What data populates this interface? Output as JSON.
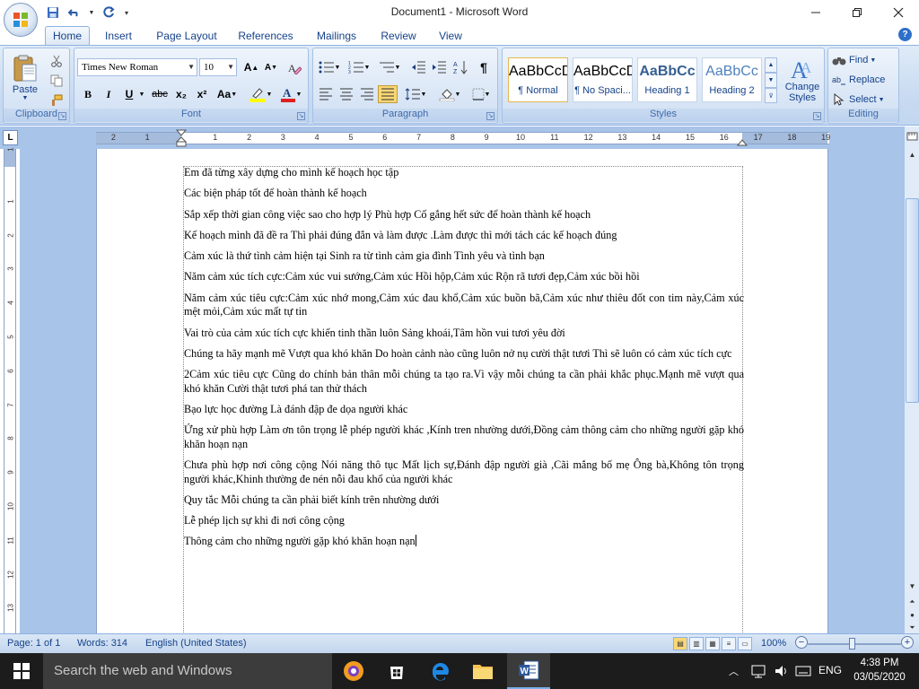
{
  "window": {
    "title": "Document1 - Microsoft Word"
  },
  "qat": {
    "save": "save-icon",
    "undo": "undo-icon",
    "redo": "redo-icon"
  },
  "tabs": [
    {
      "label": "Home",
      "active": true
    },
    {
      "label": "Insert"
    },
    {
      "label": "Page Layout"
    },
    {
      "label": "References"
    },
    {
      "label": "Mailings"
    },
    {
      "label": "Review"
    },
    {
      "label": "View"
    }
  ],
  "ribbon": {
    "clipboard": {
      "label": "Clipboard",
      "paste": "Paste"
    },
    "font": {
      "label": "Font",
      "name": "Times New Roman",
      "size": "10",
      "bold": "B",
      "italic": "I",
      "underline": "U",
      "strike": "abc",
      "sub": "x₂",
      "sup": "x²",
      "case": "Aa",
      "grow": "A",
      "shrink": "A"
    },
    "paragraph": {
      "label": "Paragraph",
      "show": "¶"
    },
    "styles": {
      "label": "Styles",
      "items": [
        {
          "preview": "AaBbCcDc",
          "name": "¶ Normal",
          "color": "#000000"
        },
        {
          "preview": "AaBbCcDc",
          "name": "¶ No Spaci...",
          "color": "#000000"
        },
        {
          "preview": "AaBbCc",
          "name": "Heading 1",
          "color": "#365f91"
        },
        {
          "preview": "AaBbCc",
          "name": "Heading 2",
          "color": "#4f81bd"
        }
      ],
      "change": "Change Styles"
    },
    "editing": {
      "label": "Editing",
      "find": "Find",
      "replace": "Replace",
      "select": "Select"
    }
  },
  "ruler": {
    "numbers": [
      "2",
      "1",
      "1",
      "2",
      "3",
      "4",
      "5",
      "6",
      "7",
      "8",
      "9",
      "10",
      "11",
      "12",
      "13",
      "14",
      "15",
      "16",
      "17",
      "18",
      "19"
    ],
    "vnumbers": [
      "1",
      "1",
      "2",
      "3",
      "4",
      "5",
      "6",
      "7",
      "8",
      "9",
      "10",
      "11",
      "12",
      "13"
    ]
  },
  "document": {
    "paragraphs": [
      "Em đã từng xây dựng cho mình kế hoạch học tập",
      "Các biện pháp tốt để hoàn thành kế hoạch",
      "Sắp xếp thời gian công việc sao cho hợp lý Phù hợp Cố gắng hết sức để hoàn thành kế hoạch",
      "Kế hoạch mình đã đề ra Thì phải đúng đắn và làm được .Làm được thì mới tách các kế hoạch đúng",
      "Cảm xúc là thứ tình cảm hiện tại Sinh ra từ tình cảm gia đình Tình yêu và tình bạn",
      "Năm cảm xúc tích cực:Cảm xúc vui sướng,Cảm xúc Hồi hộp,Cảm xúc Rộn rã tươi đẹp,Cảm xúc bồi hồi",
      "Năm cảm xúc tiêu cực:Cảm xúc nhớ mong,Cảm xúc đau khổ,Cảm xúc buồn bã,Cảm xúc như thiêu đốt con tim này,Cảm xúc mệt mỏi,Cảm xúc mất tự tin",
      "Vai trò của cảm xúc tích cực khiến tinh thần luôn Sảng khoái,Tâm hồn vui tươi yêu đời",
      "Chúng ta hãy mạnh mẽ Vượt qua khó khăn Do hoàn cảnh nào cũng luôn nở nụ cười thật tươi Thì sẽ luôn có cảm xúc tích cực",
      "2Cảm xúc tiêu cực Cũng do chính bản thân mỗi chúng ta tạo ra.Vì vậy mỗi chúng ta cần phải khắc phục.Mạnh mẽ vượt qua khó khăn Cười thật tươi phá tan thử thách",
      "Bạo lực học đường Là đánh đập đe dọa người khác",
      "Ứng xử phù hợp Làm ơn tôn trọng lễ phép người khác ,Kính tren nhường dưới,Đồng cảm thông cảm cho những người gặp khó khăn hoạn nạn",
      "Chưa phù hợp nơi công cộng Nói năng thô tục Mất lịch sự,Đánh đập người già ,Cãi mắng bố mẹ Ông bà,Không tôn trọng người khác,Khinh thường đe nén nỗi đau khổ của người khác",
      "Quy tắc Mỗi chúng ta cần phải biết kính trên nhường dưới",
      "Lễ phép lịch sự khi đi nơi công cộng",
      "Thông cảm cho những người gặp khó khăn hoạn nạn"
    ]
  },
  "status": {
    "page": "Page: 1 of 1",
    "words": "Words: 314",
    "language": "English (United States)",
    "zoom": "100%",
    "zoom_minus": "−",
    "zoom_plus": "+"
  },
  "taskbar": {
    "search": "Search the web and Windows",
    "lang": "ENG",
    "time": "4:38 PM",
    "date": "03/05/2020"
  }
}
